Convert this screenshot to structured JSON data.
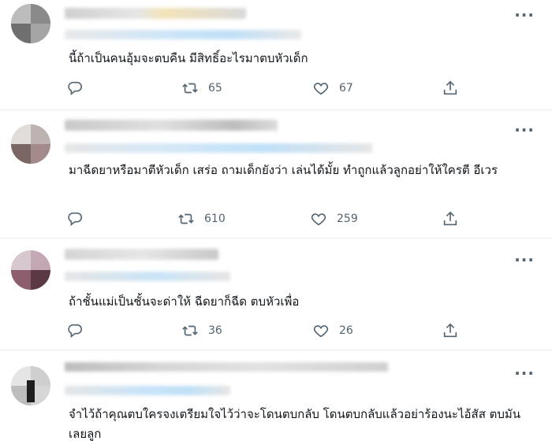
{
  "tweets": [
    {
      "text": "นี้ถ้าเป็นคนอุ้มจะตบคืน มีสิทธิ์อะไรมาตบหัวเด็ก",
      "retweets": "65",
      "likes": "67"
    },
    {
      "text": "มาฉีดยาหรือมาตีหัวเด็ก เสร่อ ถามเด็กยังว่า เล่นได้มั้ย ทำถูกแล้วลูกอย่าให้ใครตี อีเวร",
      "retweets": "610",
      "likes": "259"
    },
    {
      "text": "ถ้าชั้นแม่เป็นชั้นจะด่าให้ ฉีดยาก็ฉีด ตบหัวเพื่อ",
      "retweets": "36",
      "likes": "26"
    },
    {
      "text": "จำไว้ถ้าคุณตบใครจงเตรียมใจไว้ว่าจะโดนตบกลับ โดนตบกลับแล้วอย่าร้องนะไอ้สัส ตบมันเลยลูก",
      "retweets": "",
      "likes": ""
    }
  ],
  "icons": {
    "reply": "reply-icon",
    "retweet": "retweet-icon",
    "like": "heart-icon",
    "share": "share-icon",
    "more": "more-icon"
  },
  "colors": {
    "text": "#0f1419",
    "muted": "#536471",
    "divider": "#e6ecf0",
    "blurred_handle": "#bfe0f7"
  }
}
